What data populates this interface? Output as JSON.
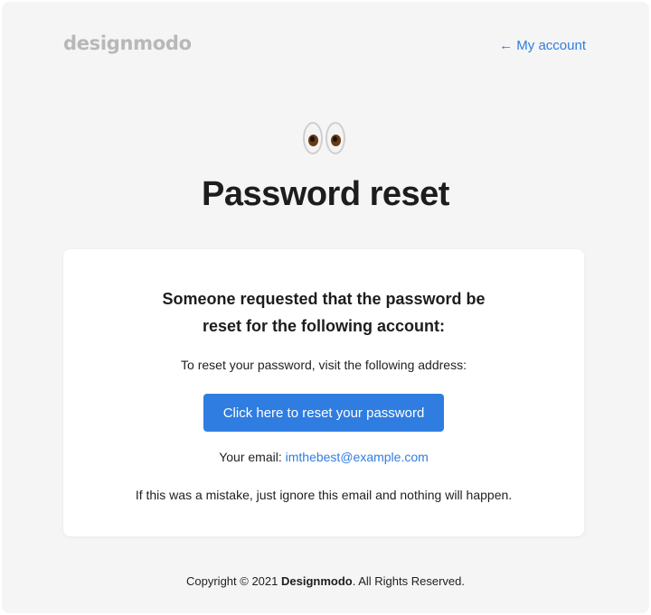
{
  "header": {
    "logo_text": "designmodo",
    "account_link": "← My account"
  },
  "hero": {
    "emoji": "eyes",
    "title": "Password reset"
  },
  "card": {
    "heading_line1": "Someone requested that the password be",
    "heading_line2": "reset for the following account:",
    "instruction": "To reset your password, visit the following address:",
    "button_label": "Click here to reset your password",
    "email_label": "Your email:",
    "email_value": "imthebest@example.com",
    "mistake_text": "If this was a mistake, just ignore this email and nothing will happen."
  },
  "footer": {
    "prefix": "Copyright © 2021",
    "brand": "Designmodo",
    "suffix": ". All Rights Reserved."
  },
  "colors": {
    "background": "#f5f5f5",
    "card": "#ffffff",
    "accent": "#2f7de1",
    "logo": "#b8b8b8",
    "text": "#1d1d1d"
  }
}
